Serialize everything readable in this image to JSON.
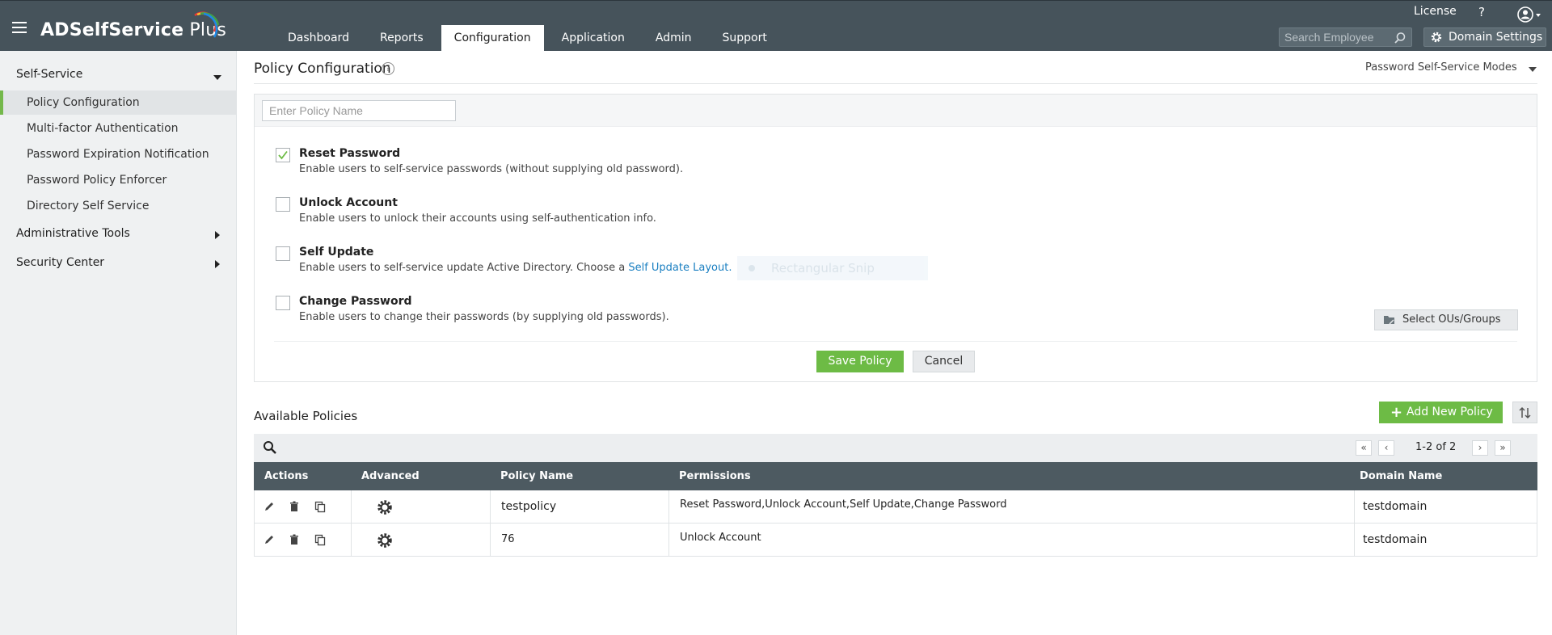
{
  "app": {
    "title_main": "ADSelfService",
    "title_plus": " Plus"
  },
  "nav": {
    "tabs": [
      "Dashboard",
      "Reports",
      "Configuration",
      "Application",
      "Admin",
      "Support"
    ],
    "active": "Configuration"
  },
  "header": {
    "license": "License",
    "help": "?",
    "search_placeholder": "Search Employee",
    "domain_settings": "Domain Settings"
  },
  "sidebar": {
    "self_service": "Self-Service",
    "items": [
      "Policy Configuration",
      "Multi-factor Authentication",
      "Password Expiration Notification",
      "Password Policy Enforcer",
      "Directory Self Service"
    ],
    "active_item": "Policy Configuration",
    "admin_tools": "Administrative Tools",
    "security_center": "Security Center"
  },
  "main": {
    "title": "Policy Configuration",
    "modes": "Password Self-Service Modes",
    "policy_name_placeholder": "Enter Policy Name",
    "options": [
      {
        "title": "Reset Password",
        "desc": "Enable users to self-service passwords (without supplying old password).",
        "checked": true
      },
      {
        "title": "Unlock Account",
        "desc": "Enable users to unlock their accounts using self-authentication info.",
        "checked": false
      },
      {
        "title": "Self Update",
        "desc": "Enable users to self-service update Active Directory. Choose a ",
        "link": "Self Update Layout.",
        "checked": false
      },
      {
        "title": "Change Password",
        "desc": "Enable users to change their passwords (by supplying old passwords).",
        "checked": false
      }
    ],
    "snip_overlay": "Rectangular Snip",
    "select_ous": "Select OUs/Groups",
    "save": "Save Policy",
    "cancel": "Cancel"
  },
  "policies": {
    "title": "Available Policies",
    "add": "Add New Policy",
    "pagination": "1-2 of 2",
    "columns": [
      "Actions",
      "Advanced",
      "Policy Name",
      "Permissions",
      "Domain Name"
    ],
    "rows": [
      {
        "name": "testpolicy",
        "permissions": "Reset Password,Unlock Account,Self Update,Change Password",
        "domain": "testdomain"
      },
      {
        "name": "76",
        "permissions": "Unlock Account",
        "domain": "testdomain"
      }
    ]
  },
  "colors": {
    "topbar": "#46535b",
    "accent_green": "#6dbb45",
    "link_blue": "#1a7fc1",
    "table_header": "#4d5a61"
  }
}
